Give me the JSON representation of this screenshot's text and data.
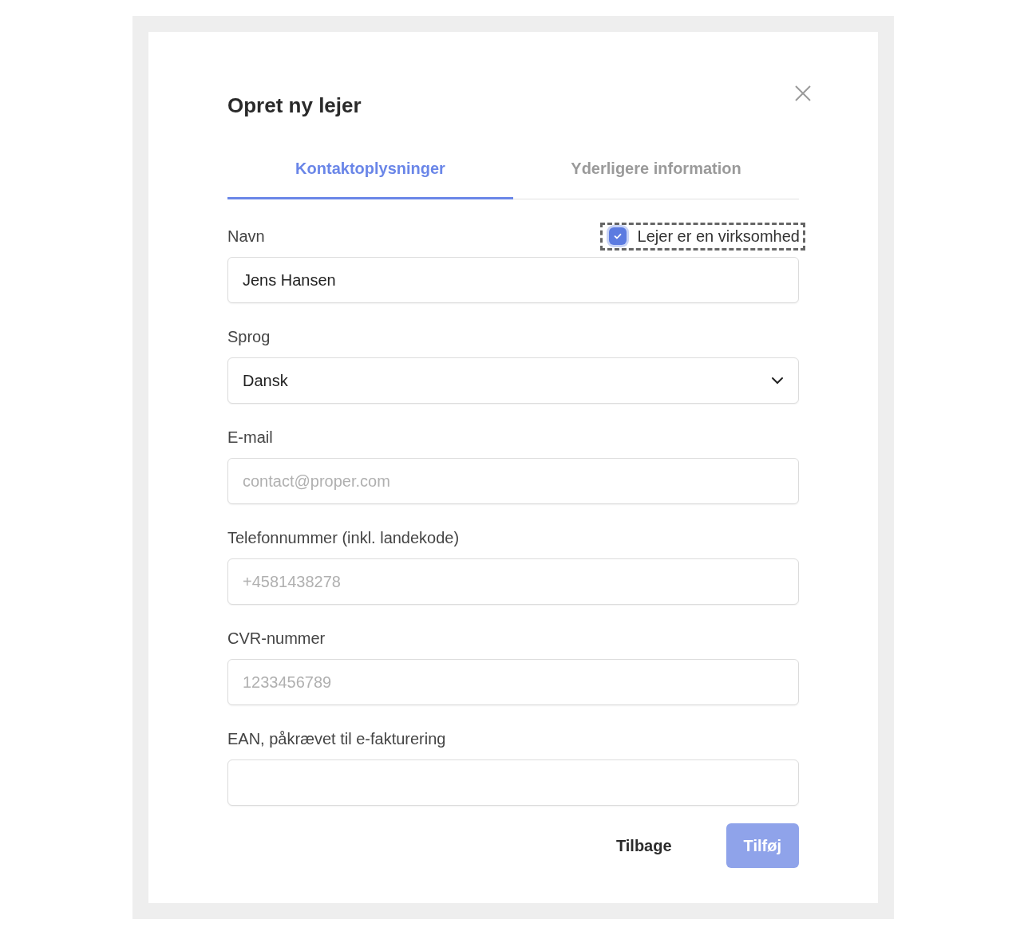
{
  "dialog": {
    "title": "Opret ny lejer"
  },
  "tabs": [
    {
      "label": "Kontaktoplysninger",
      "selected": true
    },
    {
      "label": "Yderligere information",
      "selected": false
    }
  ],
  "company_checkbox": {
    "label": "Lejer er en virksomhed",
    "checked": true
  },
  "fields": [
    {
      "kind": "text",
      "label": "Navn",
      "value": "Jens Hansen"
    },
    {
      "kind": "select",
      "label": "Sprog",
      "value": "Dansk"
    },
    {
      "kind": "text",
      "label": "E-mail",
      "placeholder": "contact@proper.com"
    },
    {
      "kind": "text",
      "label": "Telefonnummer (inkl. landekode)",
      "placeholder": "+4581438278"
    },
    {
      "kind": "text",
      "label": "CVR-nummer",
      "placeholder": "1233456789"
    },
    {
      "kind": "text",
      "label": "EAN, påkrævet til e-fakturering"
    }
  ],
  "buttons": [
    {
      "label": "Tilbage",
      "kind": "secondary",
      "disabled": false
    },
    {
      "label": "Tilføj",
      "kind": "primary",
      "disabled": true
    }
  ]
}
